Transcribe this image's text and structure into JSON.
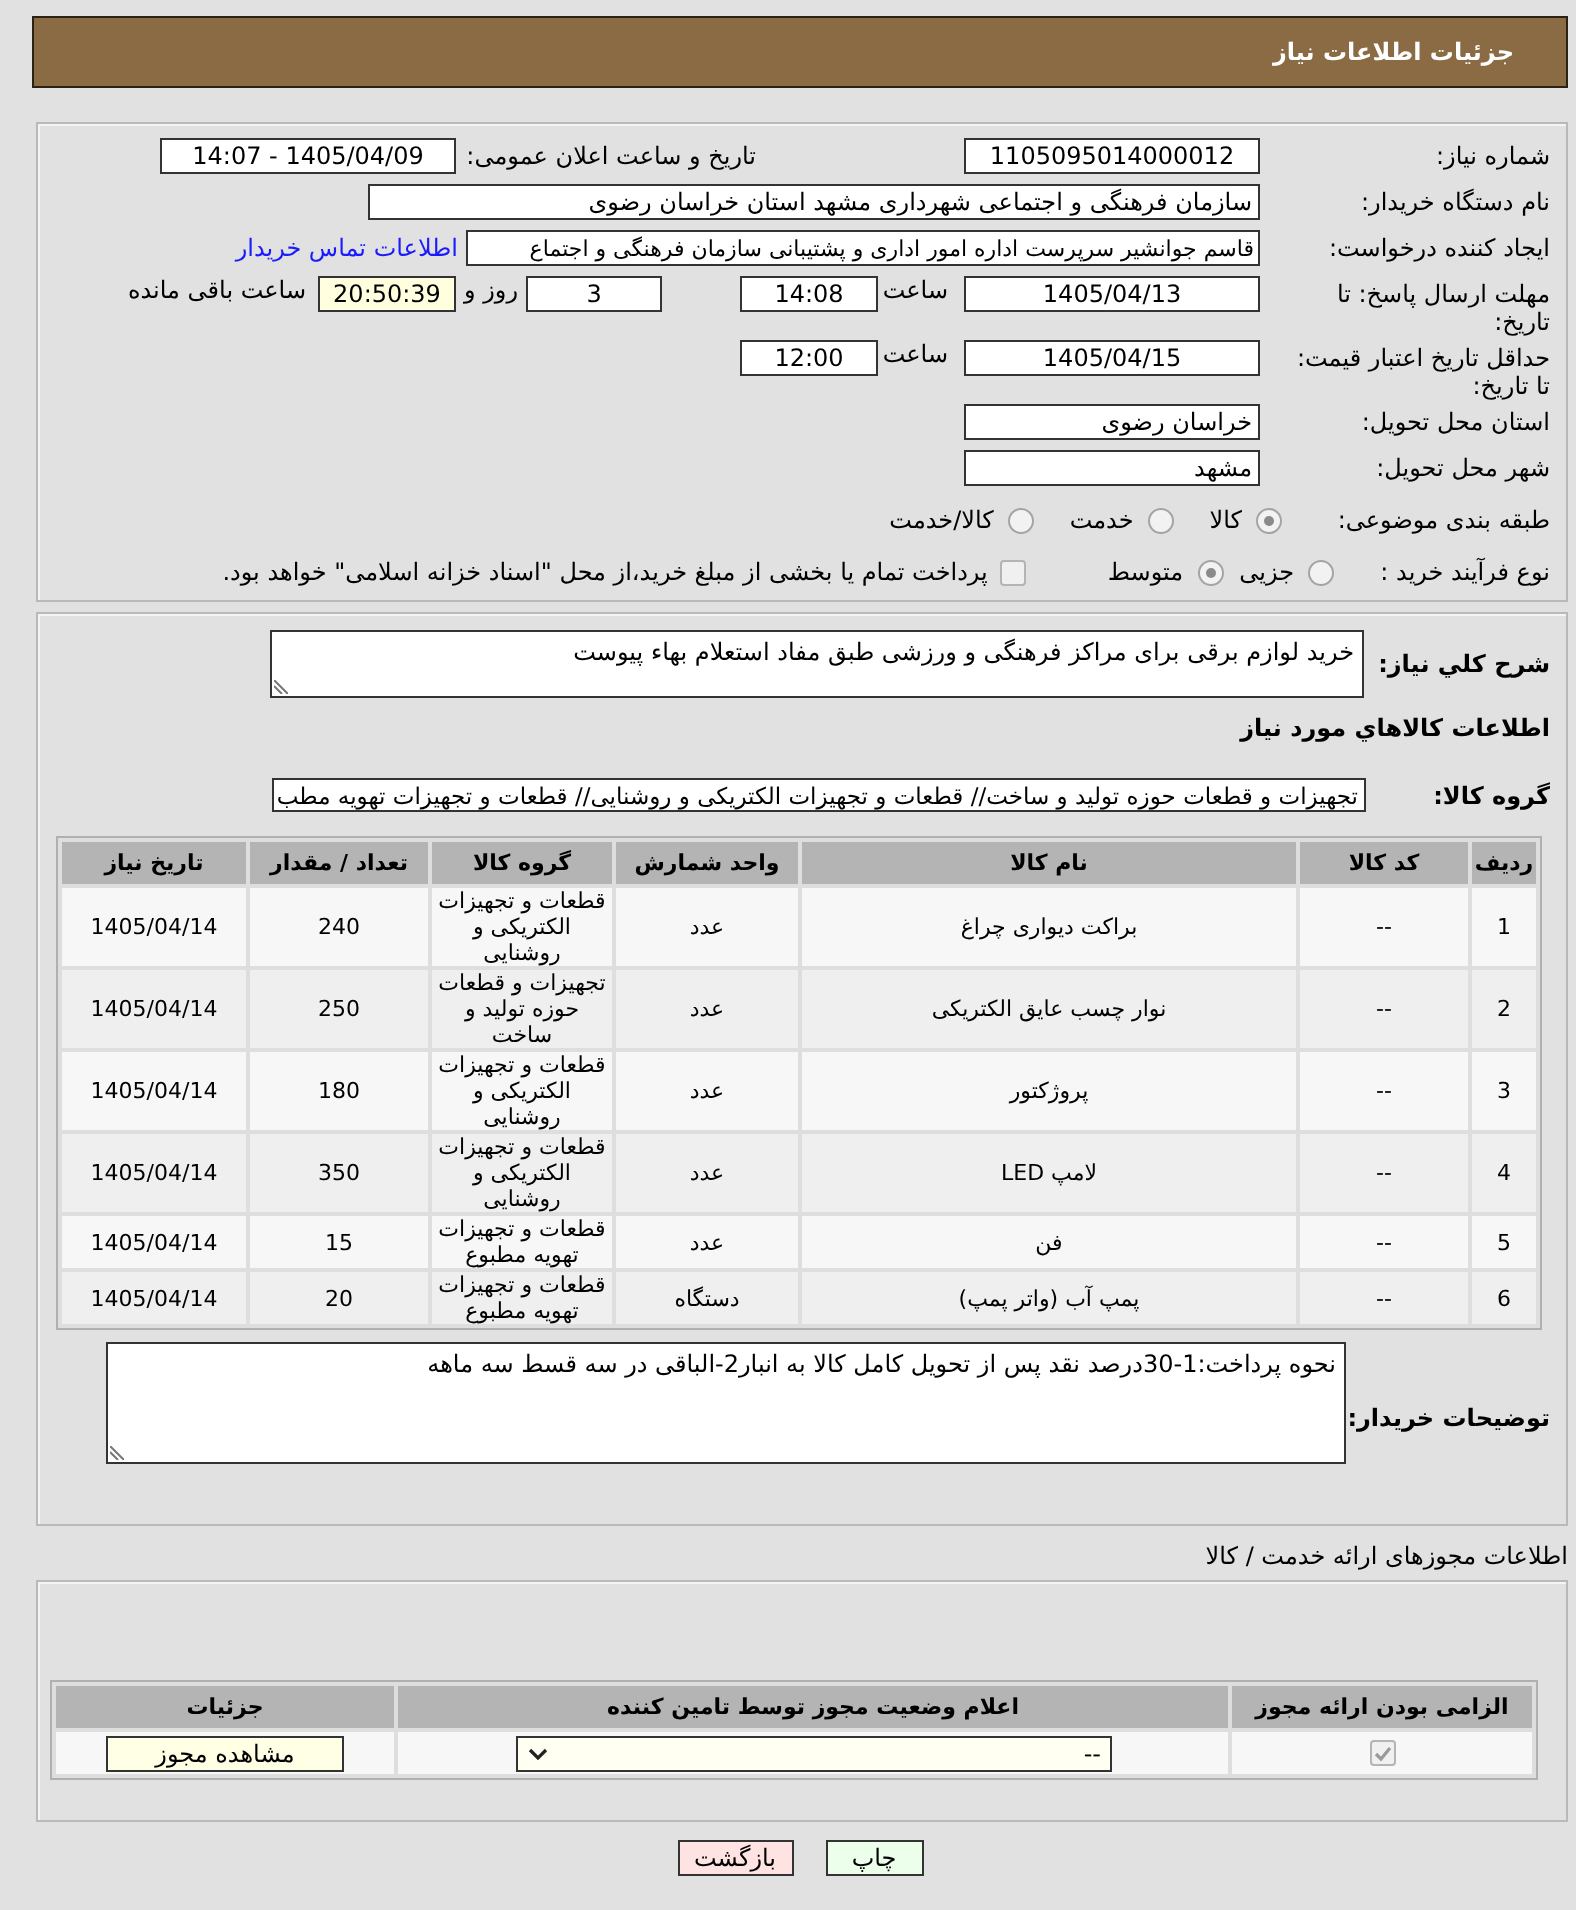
{
  "header": {
    "title": "جزئیات اطلاعات نیاز"
  },
  "need_details": {
    "need_number": {
      "label": "شماره نیاز:",
      "value": "1105095014000012"
    },
    "announcement": {
      "label": "تاریخ و ساعت اعلان عمومی:",
      "value": "1405/04/09 - 14:07"
    },
    "buyer_organization": {
      "label": "نام دستگاه خریدار:",
      "value": "سازمان فرهنگی و اجتماعی شهرداری مشهد استان خراسان رضوی"
    },
    "requester": {
      "label": "ایجاد کننده درخواست:",
      "value": "قاسم جوانشیر سرپرست اداره امور اداری و پشتیبانی سازمان فرهنگی و اجتماع",
      "contact_link": "اطلاعات تماس خریدار"
    },
    "response_deadline": {
      "label": "مهلت ارسال پاسخ: تا تاریخ:",
      "date": "1405/04/13",
      "time_label": "ساعت",
      "time": "14:08",
      "days": "3",
      "days_label": "روز و",
      "remaining": "20:50:39",
      "remaining_label": "ساعت باقی مانده"
    },
    "price_validity": {
      "label": "حداقل تاریخ اعتبار قیمت: تا تاریخ:",
      "date": "1405/04/15",
      "time_label": "ساعت",
      "time": "12:00"
    },
    "delivery_province": {
      "label": "استان محل تحویل:",
      "value": "خراسان رضوی"
    },
    "delivery_city": {
      "label": "شهر محل تحویل:",
      "value": "مشهد"
    },
    "subject_category": {
      "label": "طبقه بندی موضوعی:",
      "options": [
        {
          "label": "کالا",
          "selected": true
        },
        {
          "label": "خدمت",
          "selected": false
        },
        {
          "label": "کالا/خدمت",
          "selected": false
        }
      ]
    },
    "purchase_type": {
      "label": "نوع فرآیند خرید :",
      "options": [
        {
          "label": "جزیی",
          "selected": false
        },
        {
          "label": "متوسط",
          "selected": true
        }
      ],
      "treasury_payment": {
        "label": "پرداخت تمام یا بخشی از مبلغ خرید،از محل \"اسناد خزانه اسلامی\" خواهد بود.",
        "checked": false
      }
    }
  },
  "goods": {
    "description": {
      "label": "شرح کلي نياز:",
      "value": "خرید لوازم برقی برای مراکز فرهنگی و ورزشی طبق مفاد استعلام بهاء پیوست"
    },
    "section_title": "اطلاعات کالاهاي مورد نياز",
    "goods_group": {
      "label": "گروه کالا:",
      "value": "تجهیزات و قطعات حوزه تولید و ساخت// قطعات و تجهیزات الکتریکی و روشنایی//  قطعات و تجهیزات تهویه مطب"
    },
    "table": {
      "columns": [
        "ردیف",
        "کد کالا",
        "نام کالا",
        "واحد شمارش",
        "گروه کالا",
        "تعداد / مقدار",
        "تاریخ نیاز"
      ],
      "rows": [
        [
          "1",
          "--",
          "براکت دیواری چراغ",
          "عدد",
          "قطعات و تجهیزات الکتریکی و روشنایی",
          "240",
          "1405/04/14"
        ],
        [
          "2",
          "--",
          "نوار چسب عایق الکتریکی",
          "عدد",
          "تجهیزات و قطعات حوزه تولید و ساخت",
          "250",
          "1405/04/14"
        ],
        [
          "3",
          "--",
          "پروژکتور",
          "عدد",
          "قطعات و تجهیزات الکتریکی و روشنایی",
          "180",
          "1405/04/14"
        ],
        [
          "4",
          "--",
          "لامپ LED",
          "عدد",
          "قطعات و تجهیزات الکتریکی و روشنایی",
          "350",
          "1405/04/14"
        ],
        [
          "5",
          "--",
          "فن",
          "عدد",
          "قطعات و تجهیزات تهویه مطبوع",
          "15",
          "1405/04/14"
        ],
        [
          "6",
          "--",
          "پمپ آب (واتر پمپ)",
          "دستگاه",
          "قطعات و تجهیزات تهویه مطبوع",
          "20",
          "1405/04/14"
        ]
      ]
    },
    "buyer_notes": {
      "label": "توضیحات خریدار:",
      "value": "نحوه پرداخت:1-30درصد نقد پس از تحویل کامل کالا به انبار2-الباقی در سه قسط سه ماهه"
    }
  },
  "permits": {
    "title": "اطلاعات مجوزهای ارائه خدمت / کالا",
    "table": {
      "columns": [
        "الزامی بودن ارائه مجوز",
        "اعلام وضعیت مجوز توسط تامین کننده",
        "جزئیات"
      ],
      "rows": [
        {
          "required": true,
          "status": "--",
          "details_button": "مشاهده مجوز"
        }
      ]
    }
  },
  "buttons": [
    {
      "label": "چاپ",
      "kind": "print"
    },
    {
      "label": "بازگشت",
      "kind": "back"
    }
  ]
}
